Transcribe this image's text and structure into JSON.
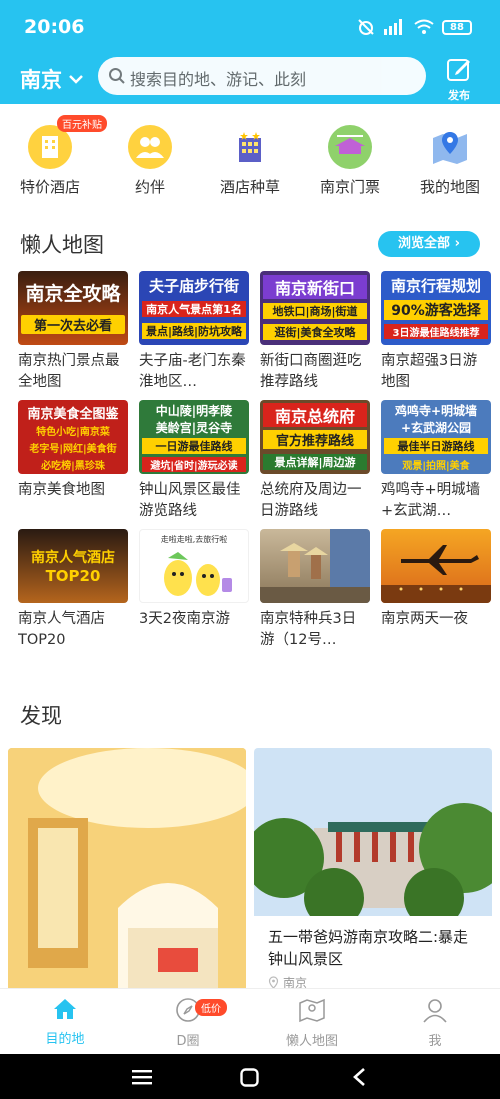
{
  "status": {
    "time": "20:06",
    "battery": "88"
  },
  "header": {
    "city": "南京",
    "search_placeholder": "搜索目的地、游记、此刻",
    "publish_label": "发布"
  },
  "quick_entries": [
    {
      "label": "特价酒店",
      "badge": "百元补贴",
      "icon": "hotel-icon"
    },
    {
      "label": "约伴",
      "icon": "companion-icon"
    },
    {
      "label": "酒店种草",
      "icon": "hotel-building-icon"
    },
    {
      "label": "南京门票",
      "icon": "ticket-icon"
    },
    {
      "label": "我的地图",
      "icon": "map-pin-icon"
    }
  ],
  "lazy_map": {
    "title": "懒人地图",
    "view_all": "浏览全部",
    "cards": [
      {
        "caption": "南京热门景点最全地图",
        "thumb": [
          "南京全攻略",
          "第一次去必看"
        ]
      },
      {
        "caption": "夫子庙-老门东秦淮地区…",
        "thumb": [
          "夫子庙步行街",
          "南京人气景点第1名",
          "景点|路线|防坑攻略"
        ]
      },
      {
        "caption": "新街口商圈逛吃推荐路线",
        "thumb": [
          "南京新街口",
          "地铁口|商场|街道",
          "逛街|美食全攻略"
        ]
      },
      {
        "caption": "南京超强3日游地图",
        "thumb": [
          "南京行程规划",
          "90%游客选择",
          "3日游最佳路线推荐"
        ]
      },
      {
        "caption": "南京美食地图",
        "thumb": [
          "南京美食全图鉴",
          "特色小吃|南京菜",
          "老字号|网红|美食街",
          "必吃榜|黑珍珠"
        ]
      },
      {
        "caption": "钟山风景区最佳游览路线",
        "thumb": [
          "中山陵|明孝陵",
          "美龄宫|灵谷寺",
          "一日游最佳路线",
          "避坑|省时|游玩必读"
        ]
      },
      {
        "caption": "总统府及周边一日游路线",
        "thumb": [
          "南京总统府",
          "官方推荐路线",
          "景点详解|周边游"
        ]
      },
      {
        "caption": "鸡鸣寺+明城墙+玄武湖…",
        "thumb": [
          "鸡鸣寺+明城墙",
          "+玄武湖公园",
          "最佳半日游路线",
          "观景|拍照|美食"
        ]
      },
      {
        "caption": "南京人气酒店TOP20",
        "thumb": [
          "南京人气酒店",
          "TOP20"
        ]
      },
      {
        "caption": "3天2夜南京游",
        "thumb": [
          "走啦走啦,去旅行啦"
        ]
      },
      {
        "caption": "南京特种兵3日游（12号…",
        "thumb": []
      },
      {
        "caption": "南京两天一夜",
        "thumb": []
      }
    ]
  },
  "discover": {
    "title": "发现",
    "posts": [
      {
        "title": "",
        "location": ""
      },
      {
        "title": "五一带爸妈游南京攻略二:暴走钟山风景区",
        "location": "南京"
      }
    ]
  },
  "tabbar": {
    "tabs": [
      {
        "label": "目的地",
        "active": true
      },
      {
        "label": "D圈",
        "badge": "低价"
      },
      {
        "label": "懒人地图"
      },
      {
        "label": "我"
      }
    ]
  },
  "colors": {
    "primary": "#27c3f0",
    "badge": "#ff4b2b"
  }
}
